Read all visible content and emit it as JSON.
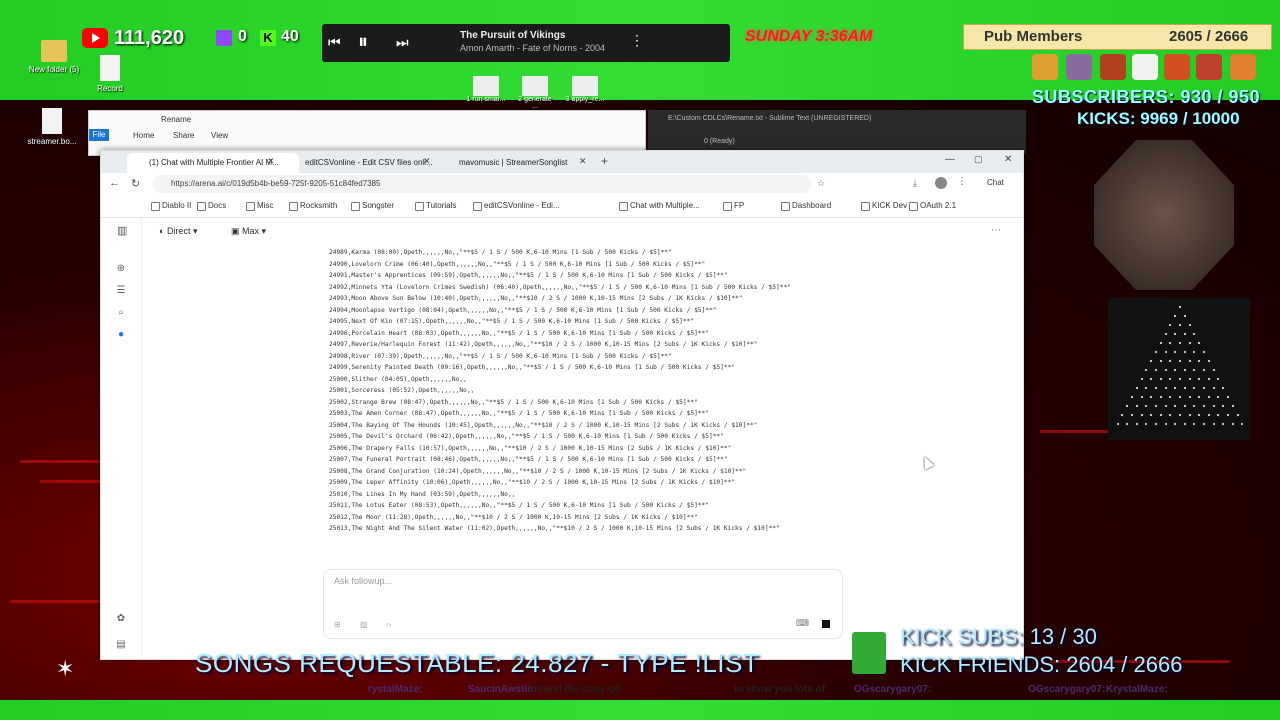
{
  "overlay": {
    "youtube_count": "111,620",
    "twitch_count": "0",
    "kick_count": "40",
    "now_playing": {
      "title": "The Pursuit of Vikings",
      "artist": "Amon Amarth - Fate of Norns - 2004"
    },
    "clock": "SUNDAY 3:36AM",
    "pub_members_label": "Pub Members",
    "pub_members_value": "2605 / 2666",
    "subscribers": "SUBSCRIBERS: 930 / 950",
    "kicks": "KICKS: 9969 / 10000",
    "songs_requestable": "SONGS REQUESTABLE: 24.827 - TYPE !LIST",
    "kick_subs": "KICK SUBS: 13 / 30",
    "kick_friends": "KICK FRIENDS: 2604 / 2666",
    "ticker": [
      {
        "name": "rystalMaze:",
        "text": ""
      },
      {
        "name": "SaucinAwstin:",
        "text": "around the capy go"
      },
      {
        "name": "",
        "text": "to show you lots of"
      },
      {
        "name": "OGscarygary07:",
        "text": ""
      },
      {
        "name": "OGscarygary07:",
        "text": ""
      },
      {
        "name": "KrystalMaze:",
        "text": ""
      }
    ]
  },
  "desktop": {
    "icons": [
      {
        "label": "New folder (5)"
      },
      {
        "label": "Record"
      },
      {
        "label": "streamer.bo..."
      }
    ],
    "taskbar_thumbs": [
      "1 run smar...",
      "2 generate ...",
      "3 apply_re..."
    ]
  },
  "explorer": {
    "title": "Rename",
    "menu": [
      "File",
      "Home",
      "Share",
      "View"
    ]
  },
  "sublime": {
    "title": "E:\\Custom CDLCs\\Rename.txt - Sublime Text (UNREGISTERED)",
    "status": "0 (Ready)"
  },
  "browser": {
    "tabs": [
      {
        "label": "(1) Chat with Multiple Frontier AI M..."
      },
      {
        "label": "editCSVonline - Edit CSV files onli..."
      },
      {
        "label": "mavomusic | StreamerSonglist"
      }
    ],
    "url": "https://arena.ai/c/019d5b4b-be59-725f-9205-51c84fed7385",
    "chat_button": "Chat",
    "bookmarks": [
      "Diablo II",
      "Docs",
      "Misc",
      "Rocksmith",
      "Songster",
      "Tutorials",
      "editCSVonline - Edi...",
      "Chat with Multiple...",
      "FP",
      "Dashboard",
      "KICK Dev",
      "OAuth 2.1"
    ],
    "mode_direct": "Direct",
    "mode_max": "Max",
    "ask_placeholder": "Ask followup...",
    "lines": [
      "24989,Karma (08:00),Opeth,,,,,,No,,\"**$5 / 1 S / 500 K,6-10 Mins [1 Sub / 500 Kicks / $5]**\"",
      "24990,Lovelorn Crime (06:40),Opeth,,,,,,No,,\"**$5 / 1 S / 500 K,6-10 Mins [1 Sub / 500 Kicks / $5]**\"",
      "24991,Master's Apprentices (09:59),Opeth,,,,,,No,,\"**$5 / 1 S / 500 K,6-10 Mins [1 Sub / 500 Kicks / $5]**\"",
      "24992,Minnets Yta (Lovelorn Crimes Swedish) (06:40),Opeth,,,,,,No,,\"**$5 / 1 S / 500 K,6-10 Mins [1 Sub / 500 Kicks / $5]**\"",
      "24993,Moon Above Sun Below (10:40),Opeth,,,,,,No,,\"**$10 / 2 S / 1000 K,10-15 Mins [2 Subs / 1K Kicks / $10]**\"",
      "24994,Moonlapse Vertigo (08:04),Opeth,,,,,,No,,\"**$5 / 1 S / 500 K,6-10 Mins [1 Sub / 500 Kicks / $5]**\"",
      "24995,Next Of Kin (07:15),Opeth,,,,,,No,,\"**$5 / 1 S / 500 K,6-10 Mins [1 Sub / 500 Kicks / $5]**\"",
      "24996,Porcelain Heart (08:03),Opeth,,,,,,No,,\"**$5 / 1 S / 500 K,6-10 Mins [1 Sub / 500 Kicks / $5]**\"",
      "24997,Reverie/Harlequin Forest (11:42),Opeth,,,,,,No,,\"**$10 / 2 S / 1000 K,10-15 Mins [2 Subs / 1K Kicks / $10]**\"",
      "24998,River (07:39),Opeth,,,,,,No,,\"**$5 / 1 S / 500 K,6-10 Mins [1 Sub / 500 Kicks / $5]**\"",
      "24999,Serenity Painted Death (09:16),Opeth,,,,,,No,,\"**$5 / 1 S / 500 K,6-10 Mins [1 Sub / 500 Kicks / $5]**\"",
      "25000,Slither (04:05),Opeth,,,,,,No,,",
      "25001,Sorceress (05:52),Opeth,,,,,,No,,",
      "25002,Strange Brew (08:47),Opeth,,,,,,No,,\"**$5 / 1 S / 500 K,6-10 Mins [1 Sub / 500 Kicks / $5]**\"",
      "25003,The Amen Corner (08:47),Opeth,,,,,,No,,\"**$5 / 1 S / 500 K,6-10 Mins [1 Sub / 500 Kicks / $5]**\"",
      "25004,The Baying Of The Hounds (10:45),Opeth,,,,,,No,,\"**$10 / 2 S / 1000 K,10-15 Mins [2 Subs / 1K Kicks / $10]**\"",
      "25005,The Devil's Orchard (06:42),Opeth,,,,,,No,,\"**$5 / 1 S / 500 K,6-10 Mins [1 Sub / 500 Kicks / $5]**\"",
      "25006,The Drapery Falls (10:57),Opeth,,,,,,No,,\"**$10 / 2 S / 1000 K,10-15 Mins [2 Subs / 1K Kicks / $10]**\"",
      "25007,The Funeral Portrait (08:46),Opeth,,,,,,No,,\"**$5 / 1 S / 500 K,6-10 Mins [1 Sub / 500 Kicks / $5]**\"",
      "25008,The Grand Conjuration (10:24),Opeth,,,,,,No,,\"**$10 / 2 S / 1000 K,10-15 Mins [2 Subs / 1K Kicks / $10]**\"",
      "25009,The Leper Affinity (10:06),Opeth,,,,,,No,,\"**$10 / 2 S / 1000 K,10-15 Mins [2 Subs / 1K Kicks / $10]**\"",
      "25010,The Lines In My Hand (03:59),Opeth,,,,,,No,,",
      "25011,The Lotus Eater (08:53),Opeth,,,,,,No,,\"**$5 / 1 S / 500 K,6-10 Mins [1 Sub / 500 Kicks / $5]**\"",
      "25012,The Moor (11:28),Opeth,,,,,,No,,\"**$10 / 2 S / 1000 K,10-15 Mins [2 Subs / 1K Kicks / $10]**\"",
      "25013,The Night And The Silent Water (11:02),Opeth,,,,,,No,,\"**$10 / 2 S / 1000 K,10-15 Mins [2 Subs / 1K Kicks / $10]**\""
    ]
  },
  "colors": {
    "green_screen": "#22cc22",
    "accent_red": "#ff1a1a",
    "overlay_text": "#aaeeff"
  }
}
